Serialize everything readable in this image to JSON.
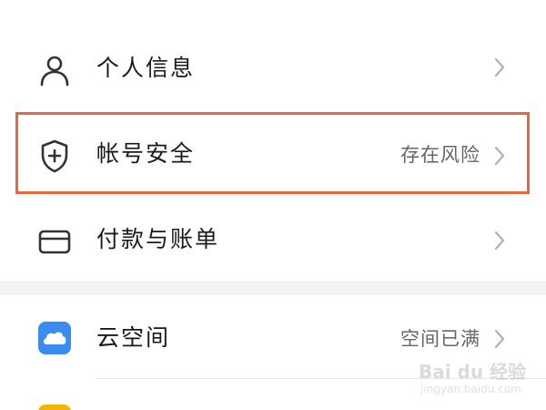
{
  "settings_list": {
    "items": [
      {
        "label": "个人信息",
        "value": "",
        "icon": "person-icon"
      },
      {
        "label": "帐号安全",
        "value": "存在风险",
        "icon": "shield-plus-icon"
      },
      {
        "label": "付款与账单",
        "value": "",
        "icon": "card-icon"
      },
      {
        "label": "云空间",
        "value": "空间已满",
        "icon": "cloud-icon"
      }
    ]
  },
  "highlight": {
    "target": "帐号安全",
    "color": "#e5683f"
  },
  "watermark": {
    "logo": "Bai du 经验",
    "url": "jingyan.baidu.com"
  },
  "colors": {
    "cloud_icon_bg": "#3b8cf0",
    "next_icon": "#f4b400",
    "secondary_text": "#666666"
  }
}
